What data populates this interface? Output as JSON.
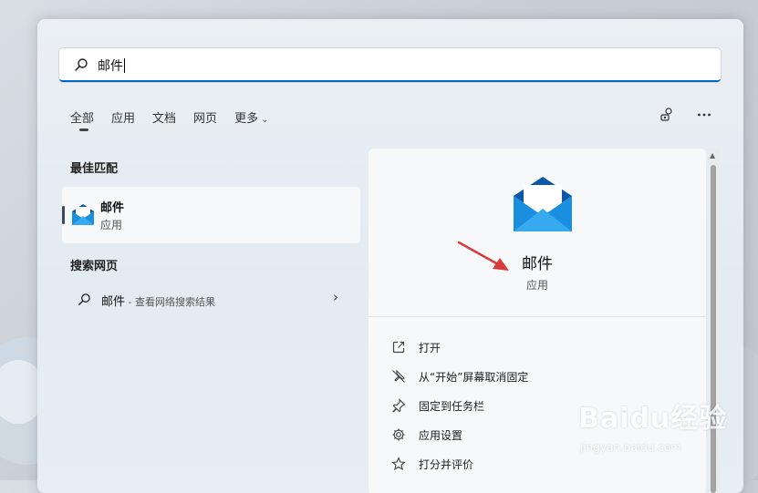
{
  "search": {
    "query": "邮件"
  },
  "tabs": [
    {
      "label": "全部",
      "active": true
    },
    {
      "label": "应用"
    },
    {
      "label": "文档"
    },
    {
      "label": "网页"
    },
    {
      "label": "更多"
    }
  ],
  "top_icons": [
    "account-switch-icon",
    "more-ellipsis-icon"
  ],
  "best_match": {
    "title": "最佳匹配",
    "name": "邮件",
    "type": "应用",
    "icon": "mail-icon"
  },
  "web_search": {
    "title": "搜索网页",
    "query": "邮件",
    "suffix": " - 查看网络搜索结果"
  },
  "detail": {
    "name": "邮件",
    "type": "应用",
    "actions": [
      {
        "label": "打开",
        "icon": "open-external-icon"
      },
      {
        "label": "从“开始”屏幕取消固定",
        "icon": "unpin-icon"
      },
      {
        "label": "固定到任务栏",
        "icon": "pin-icon"
      },
      {
        "label": "应用设置",
        "icon": "gear-icon"
      },
      {
        "label": "打分并评价",
        "icon": "star-icon"
      }
    ]
  },
  "watermark": {
    "main": "Baidu经验",
    "sub": "jingyan.baidu.com"
  },
  "colors": {
    "accent": "#0067c0",
    "mail_blue": "#1a8fe0",
    "arrow_red": "#e03c3c"
  }
}
